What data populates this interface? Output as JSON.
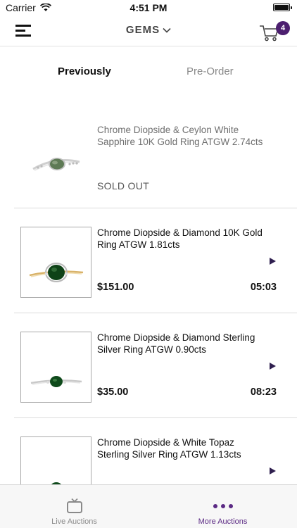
{
  "status_bar": {
    "carrier": "Carrier",
    "time": "4:51 PM"
  },
  "nav": {
    "title": "GEMS",
    "cart_count": "4"
  },
  "tabs": {
    "previously": "Previously",
    "preorder": "Pre-Order"
  },
  "items": [
    {
      "title": "Chrome Diopside & Ceylon White Sapphire 10K Gold Ring ATGW 2.74cts",
      "status": "SOLD OUT"
    },
    {
      "title": "Chrome Diopside & Diamond 10K Gold Ring ATGW 1.81cts",
      "price": "$151.00",
      "timer": "05:03"
    },
    {
      "title": "Chrome Diopside & Diamond Sterling Silver Ring ATGW 0.90cts",
      "price": "$35.00",
      "timer": "08:23"
    },
    {
      "title": "Chrome Diopside & White Topaz Sterling Silver Ring ATGW 1.13cts"
    }
  ],
  "tab_bar": {
    "live": "Live Auctions",
    "more": "More Auctions"
  },
  "colors": {
    "accent": "#5b2a84",
    "badge": "#4c1f6f"
  }
}
